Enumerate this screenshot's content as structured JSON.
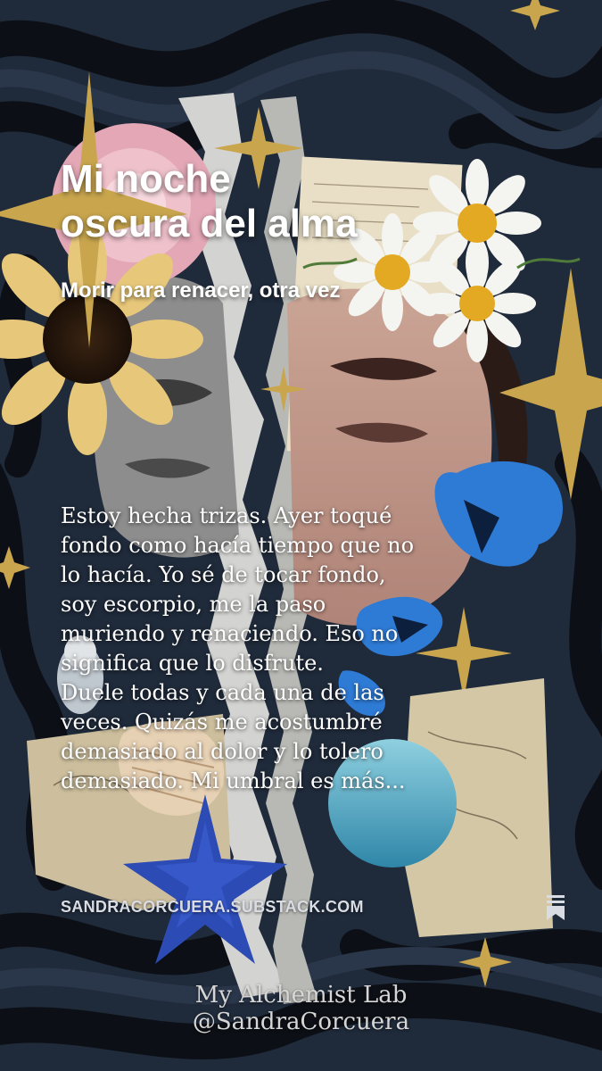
{
  "story": {
    "title_lines": [
      "Mi noche",
      "oscura del alma"
    ],
    "subtitle": "Morir para renacer, otra vez",
    "excerpt_lines": [
      "Estoy hecha trizas. Ayer toqué",
      "fondo como hacía tiempo que no",
      "lo hacía. Yo sé de tocar fondo,",
      "soy escorpio, me la paso",
      "muriendo y renaciendo. Eso no",
      "significa que lo disfrute.",
      "Duele todas y cada una de las",
      "veces. Quizás me acostumbré",
      "demasiado al dolor y lo tolero",
      "demasiado. Mi umbral es más..."
    ]
  },
  "footer": {
    "domain": "SANDRACORCUERA.SUBSTACK.COM",
    "bookmark_icon": "bookmark-icon"
  },
  "watermark": {
    "lines": [
      "My Alchemist Lab",
      "@SandraCorcuera"
    ]
  },
  "colors": {
    "background": "#1f2a3a",
    "swirl": "#0c0f15",
    "text": "#ffffff",
    "butterfly": "#2e7bd6",
    "starfish": "#2d4bb5",
    "glitter": "#c9a64e"
  }
}
